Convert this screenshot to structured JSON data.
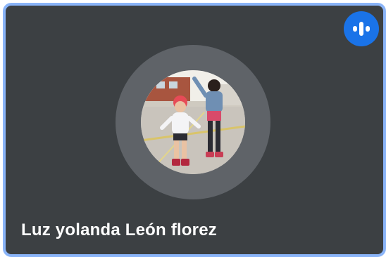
{
  "participant": {
    "name": "Luz yolanda León florez",
    "status_icon": "audio-level-icon",
    "avatar_icon": "profile-photo-icon"
  },
  "colors": {
    "tile_background": "#3c4043",
    "active_speaker_border": "#8ab4f8",
    "avatar_ring": "#5f6368",
    "speaking_indicator": "#1a73e8",
    "name_text": "#ffffff"
  }
}
